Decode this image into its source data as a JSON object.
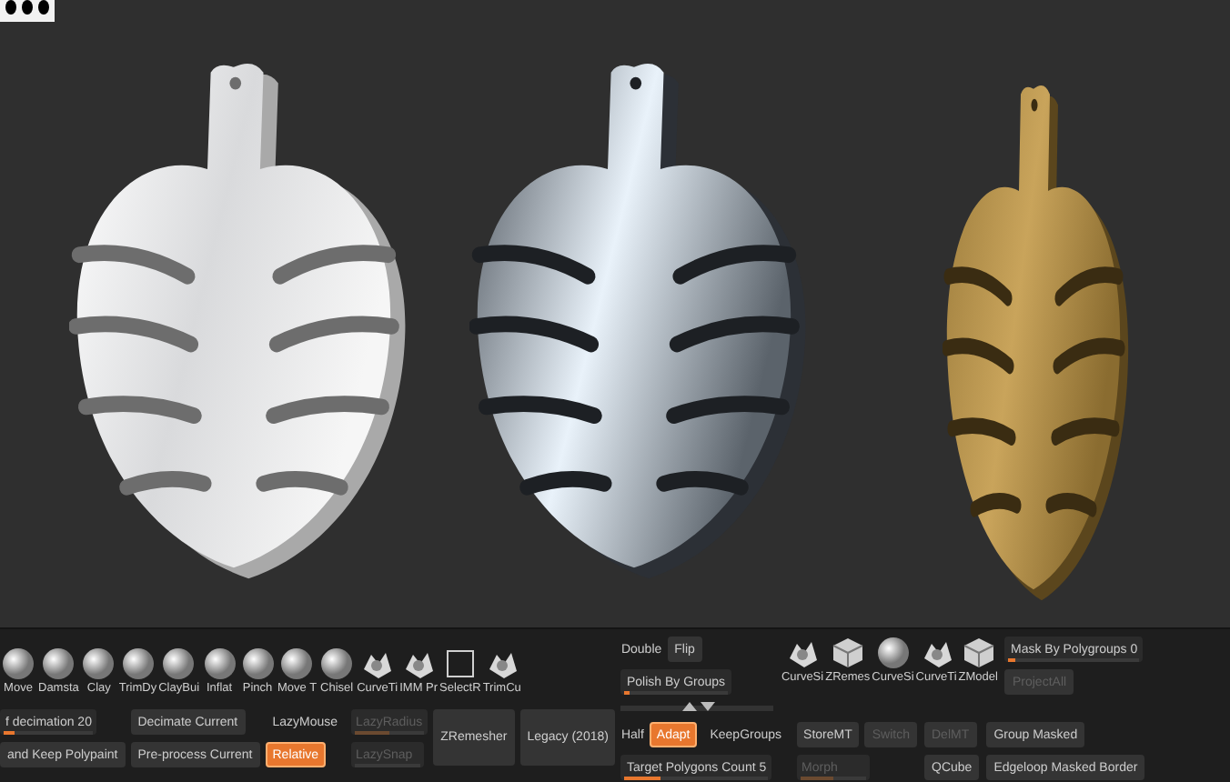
{
  "viewport": {
    "renders": [
      {
        "kind": "white"
      },
      {
        "kind": "chrome"
      },
      {
        "kind": "gold"
      }
    ]
  },
  "tools": [
    {
      "label": "Move",
      "kind": "sphere"
    },
    {
      "label": "Damsta",
      "kind": "sphere"
    },
    {
      "label": "Clay",
      "kind": "sphere"
    },
    {
      "label": "TrimDy",
      "kind": "sphere"
    },
    {
      "label": "ClayBui",
      "kind": "sphere"
    },
    {
      "label": "Inflat",
      "kind": "sphere"
    },
    {
      "label": "Pinch",
      "kind": "sphere"
    },
    {
      "label": "Move T",
      "kind": "sphere"
    },
    {
      "label": "Chisel",
      "kind": "sphere"
    },
    {
      "label": "CurveTi",
      "kind": "mesh"
    },
    {
      "label": "IMM Pr",
      "kind": "mesh"
    },
    {
      "label": "SelectR",
      "kind": "square"
    },
    {
      "label": "TrimCu",
      "kind": "mesh"
    }
  ],
  "left_groups": [
    {
      "rows": [
        [
          {
            "kind": "slider",
            "label": "f decimation 20",
            "level": 0.12,
            "disabled": false
          }
        ],
        [
          {
            "kind": "button",
            "label": "and Keep Polypaint",
            "disabled": false
          }
        ]
      ]
    },
    {
      "rows": [
        [
          {
            "kind": "button",
            "label": "Decimate Current",
            "disabled": false
          }
        ],
        [
          {
            "kind": "button",
            "label": "Pre-process Current",
            "disabled": false
          }
        ]
      ]
    },
    {
      "rows": [
        [
          {
            "kind": "toggle",
            "label": "LazyMouse",
            "selected": false,
            "disabled": false
          }
        ],
        [
          {
            "kind": "toggle",
            "label": "Relative",
            "selected": true,
            "disabled": false
          }
        ]
      ]
    },
    {
      "rows": [
        [
          {
            "kind": "slider",
            "label": "LazyRadius",
            "level": 0.5,
            "disabled": true
          }
        ],
        [
          {
            "kind": "slider",
            "label": "LazySnap",
            "level": 0,
            "disabled": true
          }
        ]
      ]
    },
    {
      "rows": [
        [
          {
            "kind": "tall",
            "label": "ZRemesher",
            "disabled": false
          }
        ]
      ]
    },
    {
      "rows": [
        [
          {
            "kind": "tall",
            "label": "Legacy (2018)",
            "disabled": false
          }
        ]
      ]
    }
  ],
  "right_top_left": {
    "rows": [
      [
        {
          "kind": "label",
          "label": "Double",
          "disabled": false
        },
        {
          "kind": "button",
          "label": "Flip",
          "disabled": false
        }
      ],
      [
        {
          "kind": "slider",
          "label": "Polish By Groups",
          "level": 0.05,
          "disabled": false
        }
      ]
    ]
  },
  "right_icons": [
    {
      "label": "CurveSi",
      "kind": "mesh"
    },
    {
      "label": "ZRemes",
      "kind": "cube"
    },
    {
      "label": "CurveSi",
      "kind": "sphere"
    },
    {
      "label": "CurveTi",
      "kind": "mesh"
    },
    {
      "label": "ZModel",
      "kind": "cube"
    }
  ],
  "right_top_right": {
    "rows": [
      [
        {
          "kind": "slider",
          "label": "Mask By Polygroups 0",
          "level": 0.05,
          "disabled": false
        }
      ],
      [
        {
          "kind": "button",
          "label": "ProjectAll",
          "disabled": true
        }
      ]
    ]
  },
  "right_groups": [
    {
      "rows": [
        [
          {
            "kind": "label",
            "label": "Half",
            "disabled": false
          },
          {
            "kind": "toggle",
            "label": "Adapt",
            "selected": true,
            "disabled": false
          },
          {
            "kind": "toggle",
            "label": "KeepGroups",
            "selected": false,
            "disabled": false
          }
        ],
        [
          {
            "kind": "slider",
            "label": "Target Polygons Count 5",
            "level": 0.25,
            "disabled": false
          }
        ]
      ]
    },
    {
      "rows": [
        [
          {
            "kind": "button",
            "label": "StoreMT",
            "disabled": false
          },
          {
            "kind": "button",
            "label": "Switch",
            "disabled": true
          }
        ],
        [
          {
            "kind": "slider",
            "label": "Morph",
            "level": 0.5,
            "disabled": true
          }
        ]
      ]
    },
    {
      "rows": [
        [
          {
            "kind": "button",
            "label": "DelMT",
            "disabled": true
          }
        ],
        [
          {
            "kind": "button",
            "label": "QCube",
            "disabled": false
          }
        ]
      ]
    },
    {
      "rows": [
        [
          {
            "kind": "button",
            "label": "Group Masked",
            "disabled": false
          }
        ],
        [
          {
            "kind": "button",
            "label": "Edgeloop Masked Border",
            "disabled": false
          }
        ]
      ]
    }
  ]
}
